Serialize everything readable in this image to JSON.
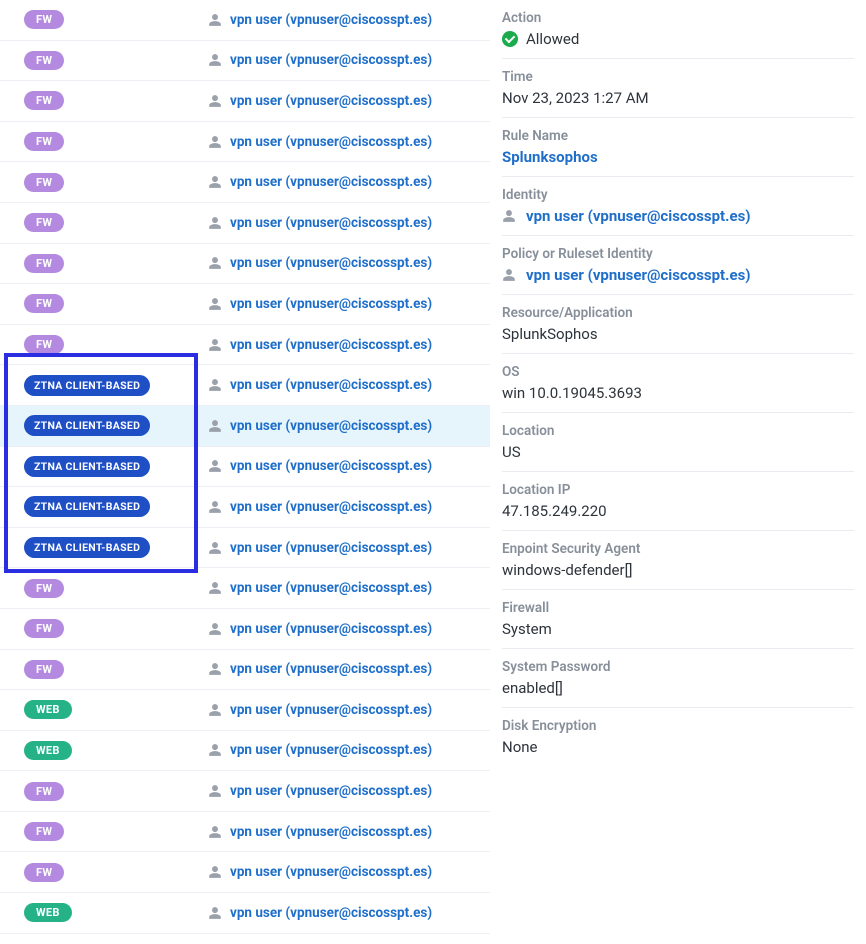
{
  "rows": [
    {
      "badge": "FW",
      "type": "fw",
      "user": "vpn user (vpnuser@ciscosspt.es)",
      "selected": false
    },
    {
      "badge": "FW",
      "type": "fw",
      "user": "vpn user (vpnuser@ciscosspt.es)",
      "selected": false
    },
    {
      "badge": "FW",
      "type": "fw",
      "user": "vpn user (vpnuser@ciscosspt.es)",
      "selected": false
    },
    {
      "badge": "FW",
      "type": "fw",
      "user": "vpn user (vpnuser@ciscosspt.es)",
      "selected": false
    },
    {
      "badge": "FW",
      "type": "fw",
      "user": "vpn user (vpnuser@ciscosspt.es)",
      "selected": false
    },
    {
      "badge": "FW",
      "type": "fw",
      "user": "vpn user (vpnuser@ciscosspt.es)",
      "selected": false
    },
    {
      "badge": "FW",
      "type": "fw",
      "user": "vpn user (vpnuser@ciscosspt.es)",
      "selected": false
    },
    {
      "badge": "FW",
      "type": "fw",
      "user": "vpn user (vpnuser@ciscosspt.es)",
      "selected": false
    },
    {
      "badge": "FW",
      "type": "fw",
      "user": "vpn user (vpnuser@ciscosspt.es)",
      "selected": false
    },
    {
      "badge": "ZTNA CLIENT-BASED",
      "type": "ztna",
      "user": "vpn user (vpnuser@ciscosspt.es)",
      "selected": false
    },
    {
      "badge": "ZTNA CLIENT-BASED",
      "type": "ztna",
      "user": "vpn user (vpnuser@ciscosspt.es)",
      "selected": true
    },
    {
      "badge": "ZTNA CLIENT-BASED",
      "type": "ztna",
      "user": "vpn user (vpnuser@ciscosspt.es)",
      "selected": false
    },
    {
      "badge": "ZTNA CLIENT-BASED",
      "type": "ztna",
      "user": "vpn user (vpnuser@ciscosspt.es)",
      "selected": false
    },
    {
      "badge": "ZTNA CLIENT-BASED",
      "type": "ztna",
      "user": "vpn user (vpnuser@ciscosspt.es)",
      "selected": false
    },
    {
      "badge": "FW",
      "type": "fw",
      "user": "vpn user (vpnuser@ciscosspt.es)",
      "selected": false
    },
    {
      "badge": "FW",
      "type": "fw",
      "user": "vpn user (vpnuser@ciscosspt.es)",
      "selected": false
    },
    {
      "badge": "FW",
      "type": "fw",
      "user": "vpn user (vpnuser@ciscosspt.es)",
      "selected": false
    },
    {
      "badge": "WEB",
      "type": "web",
      "user": "vpn user (vpnuser@ciscosspt.es)",
      "selected": false
    },
    {
      "badge": "WEB",
      "type": "web",
      "user": "vpn user (vpnuser@ciscosspt.es)",
      "selected": false
    },
    {
      "badge": "FW",
      "type": "fw",
      "user": "vpn user (vpnuser@ciscosspt.es)",
      "selected": false
    },
    {
      "badge": "FW",
      "type": "fw",
      "user": "vpn user (vpnuser@ciscosspt.es)",
      "selected": false
    },
    {
      "badge": "FW",
      "type": "fw",
      "user": "vpn user (vpnuser@ciscosspt.es)",
      "selected": false
    },
    {
      "badge": "WEB",
      "type": "web",
      "user": "vpn user (vpnuser@ciscosspt.es)",
      "selected": false
    }
  ],
  "detail": {
    "action_label": "Action",
    "action_value": "Allowed",
    "time_label": "Time",
    "time_value": "Nov 23, 2023 1:27 AM",
    "rule_label": "Rule Name",
    "rule_value": "Splunksophos",
    "identity_label": "Identity",
    "identity_value": "vpn user (vpnuser@ciscosspt.es)",
    "policy_label": "Policy or Ruleset Identity",
    "policy_value": "vpn user (vpnuser@ciscosspt.es)",
    "resource_label": "Resource/Application",
    "resource_value": "SplunkSophos",
    "os_label": "OS",
    "os_value": "win 10.0.19045.3693",
    "location_label": "Location",
    "location_value": "US",
    "ip_label": "Location IP",
    "ip_value": "47.185.249.220",
    "agent_label": "Enpoint Security Agent",
    "agent_value": "windows-defender[]",
    "firewall_label": "Firewall",
    "firewall_value": "System",
    "syspwd_label": "System Password",
    "syspwd_value": "enabled[]",
    "disk_label": "Disk Encryption",
    "disk_value": "None"
  }
}
